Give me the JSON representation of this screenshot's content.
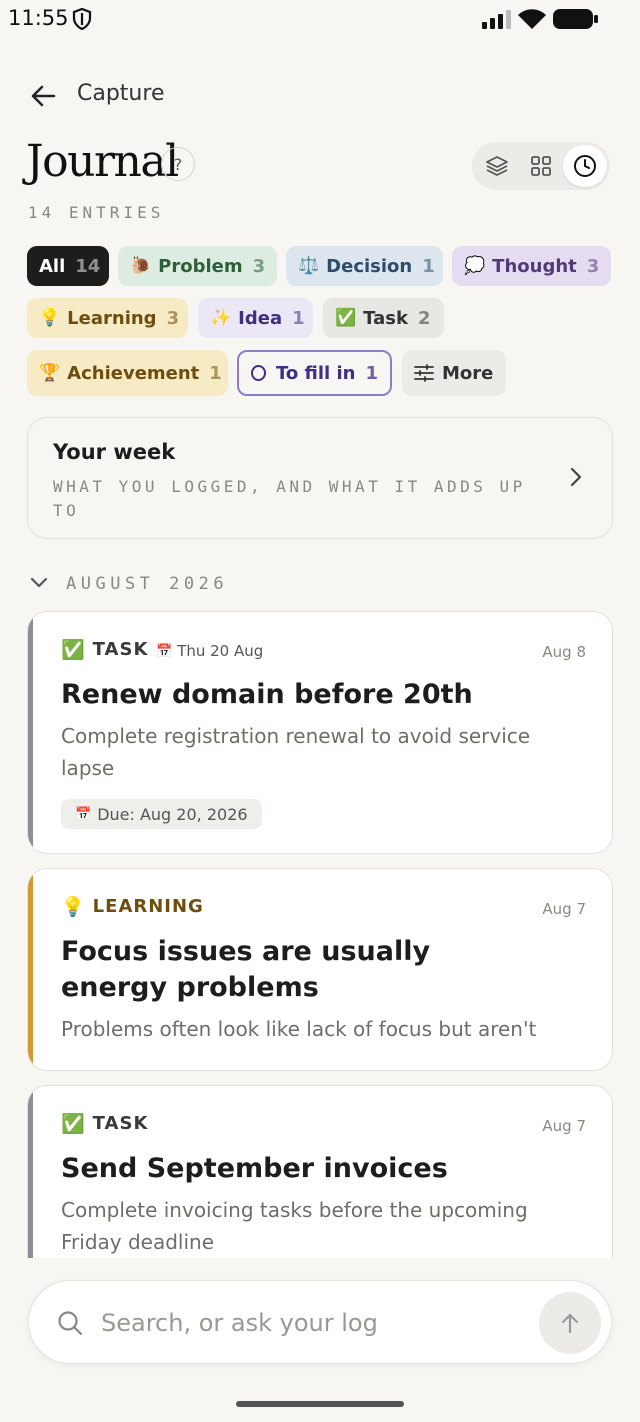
{
  "status_bar": {
    "time": "11:55"
  },
  "header": {
    "back_label": "Capture",
    "title": "Journal",
    "help": "?",
    "entries": "14 ENTRIES"
  },
  "view_toggle": {
    "options": [
      "stack-view",
      "grid-view",
      "timeline-view"
    ],
    "active": "timeline-view"
  },
  "filters": {
    "all": {
      "label": "All",
      "count": "14"
    },
    "problem": {
      "emoji": "🐌",
      "label": "Problem",
      "count": "3"
    },
    "decision": {
      "emoji": "⚖️",
      "label": "Decision",
      "count": "1"
    },
    "thought": {
      "emoji": "💭",
      "label": "Thought",
      "count": "3"
    },
    "learning": {
      "emoji": "💡",
      "label": "Learning",
      "count": "3"
    },
    "idea": {
      "emoji": "✨",
      "label": "Idea",
      "count": "1"
    },
    "task": {
      "emoji": "✅",
      "label": "Task",
      "count": "2"
    },
    "achievement": {
      "emoji": "🏆",
      "label": "Achievement",
      "count": "1"
    },
    "to_fill_in": {
      "label": "To fill in",
      "count": "1"
    },
    "more": {
      "label": "More"
    }
  },
  "week_card": {
    "title": "Your week",
    "subtitle": "WHAT YOU LOGGED, AND WHAT IT ADDS UP TO"
  },
  "month": {
    "label": "AUGUST 2026"
  },
  "entries": [
    {
      "type_emoji": "✅",
      "type": "TASK",
      "due_emoji": "📅",
      "due_inline": "Thu 20 Aug",
      "date": "Aug 8",
      "title": "Renew domain before 20th",
      "description": "Complete registration renewal to avoid service lapse",
      "due_pill": "Due: Aug 20, 2026",
      "accent": "#8e8e96",
      "type_color": "#3a3a3a"
    },
    {
      "type_emoji": "💡",
      "type": "LEARNING",
      "date": "Aug 7",
      "title": "Focus issues are usually energy problems",
      "description": "Problems often look like lack of focus but aren't",
      "accent": "#d49a2f",
      "type_color": "#6d4e0e"
    },
    {
      "type_emoji": "✅",
      "type": "TASK",
      "date": "Aug 7",
      "title": "Send September invoices",
      "description": "Complete invoicing tasks before the upcoming Friday deadline",
      "accent": "#8e8e96",
      "type_color": "#3a3a3a"
    }
  ],
  "search": {
    "placeholder": "Search, or ask your log"
  }
}
